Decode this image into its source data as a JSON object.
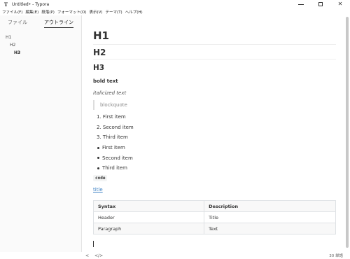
{
  "window": {
    "app_icon": "T",
    "title": "Untitled• - Typora"
  },
  "menu": [
    "ファイル(F)",
    "編集(E)",
    "段落(P)",
    "フォーマット(O)",
    "表示(V)",
    "テーマ(T)",
    "ヘルプ(H)"
  ],
  "sidebar": {
    "tabs": [
      "ファイル",
      "アウトライン"
    ],
    "active_tab": "アウトライン",
    "outline": [
      "H1",
      "H2",
      "H3"
    ]
  },
  "document": {
    "h1": "H1",
    "h2": "H2",
    "h3": "H3",
    "bold": "bold text",
    "italic": "italicized text",
    "blockquote": "blockquote",
    "ordered_list": [
      "First item",
      "Second item",
      "Third item"
    ],
    "ordered_markers": [
      "1.",
      "2.",
      "3."
    ],
    "unordered_list": [
      "First item",
      "Second item",
      "Third item"
    ],
    "code": "code",
    "link": "title",
    "table": {
      "headers": [
        "Syntax",
        "Description"
      ],
      "rows": [
        [
          "Header",
          "Title"
        ],
        [
          "Paragraph",
          "Text"
        ]
      ]
    }
  },
  "status": {
    "toggle_sidebar": "<",
    "source_mode": "</>",
    "word_count": "30 単語"
  }
}
